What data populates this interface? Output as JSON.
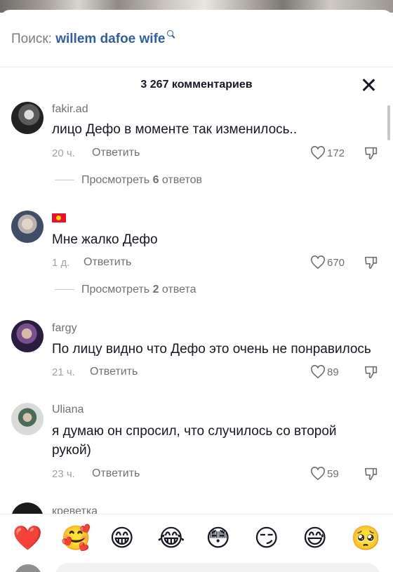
{
  "search": {
    "label": "Поиск:",
    "query": "willem dafoe wife"
  },
  "comments_header": {
    "count_label": "3 267 комментариев"
  },
  "comments": [
    {
      "username": "fakir.ad",
      "text": "лицо Дефо в моменте так изменилось..",
      "time": "20 ч.",
      "reply_label": "Ответить",
      "likes": "172",
      "replies": {
        "prefix": "Просмотреть",
        "count": "6",
        "suffix": "ответов"
      }
    },
    {
      "username": "",
      "flag": "kyrgyzstan-flag",
      "text": "Мне жалко Дефо",
      "time": "1 д.",
      "reply_label": "Ответить",
      "likes": "670",
      "replies": {
        "prefix": "Просмотреть",
        "count": "2",
        "suffix": "ответа"
      }
    },
    {
      "username": "fargy",
      "text": "По лицу видно что Дефо это очень не понравилось",
      "time": "21 ч.",
      "reply_label": "Ответить",
      "likes": "89"
    },
    {
      "username": "Uliana",
      "text": "я думаю он спросил, что случилось со второй рукой)",
      "time": "23 ч.",
      "reply_label": "Ответить",
      "likes": "59"
    },
    {
      "username": "креветка"
    }
  ],
  "emoji_bar": [
    "❤️",
    "🥰",
    "😁",
    "😂",
    "😳",
    "😏",
    "😅",
    "🥺"
  ],
  "icons": {
    "search": "search-icon",
    "close": "close-icon",
    "like": "heart-outline-icon",
    "dislike": "thumbs-down-icon"
  },
  "colors": {
    "accent_link": "#2f5fa0",
    "text_primary": "#161823",
    "text_secondary": "#6f7179"
  }
}
